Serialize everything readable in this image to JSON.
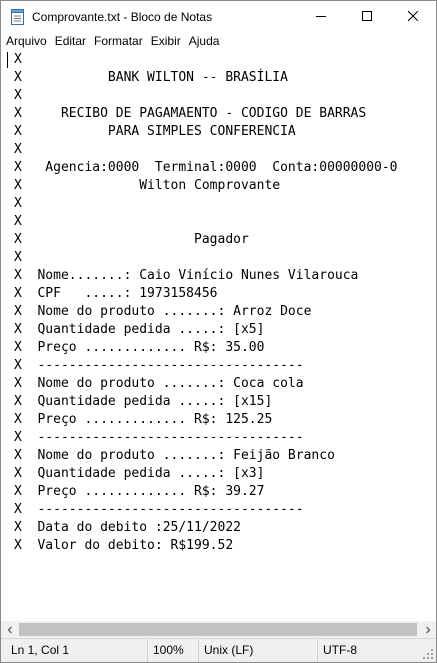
{
  "window": {
    "title": "Comprovante.txt - Bloco de Notas"
  },
  "icons": {
    "app": "notepad-icon",
    "minimize": "minimize-icon",
    "maximize": "maximize-icon",
    "close": "close-icon",
    "scroll_left": "chevron-left-icon",
    "scroll_right": "chevron-right-icon",
    "resize": "resize-grip-icon"
  },
  "menu": {
    "items": [
      "Arquivo",
      "Editar",
      "Formatar",
      "Exibir",
      "Ajuda"
    ]
  },
  "document": {
    "lines": [
      "X",
      "X           BANK WILTON -- BRASÍLIA",
      "X",
      "X     RECIBO DE PAGAMAENTO - CODIGO DE BARRAS",
      "X           PARA SIMPLES CONFERENCIA",
      "X",
      "X   Agencia:0000  Terminal:0000  Conta:00000000-0",
      "X               Wilton Comprovante",
      "X",
      "X",
      "X                      Pagador",
      "X",
      "X  Nome.......: Caio Vinício Nunes Vilarouca",
      "X  CPF   .....: 1973158456",
      "X  Nome do produto .......: Arroz Doce",
      "X  Quantidade pedida .....: [x5]",
      "X  Preço ............. R$: 35.00",
      "X  ----------------------------------",
      "X  Nome do produto .......: Coca cola",
      "X  Quantidade pedida .....: [x15]",
      "X  Preço ............. R$: 125.25",
      "X  ----------------------------------",
      "X  Nome do produto .......: Feijão Branco",
      "X  Quantidade pedida .....: [x3]",
      "X  Preço ............. R$: 39.27",
      "X  ----------------------------------",
      "X  Data do debito :25/11/2022",
      "X  Valor do debito: R$199.52"
    ]
  },
  "status": {
    "position": "Ln 1, Col 1",
    "zoom": "100%",
    "line_ending": "Unix (LF)",
    "encoding": "UTF-8"
  }
}
